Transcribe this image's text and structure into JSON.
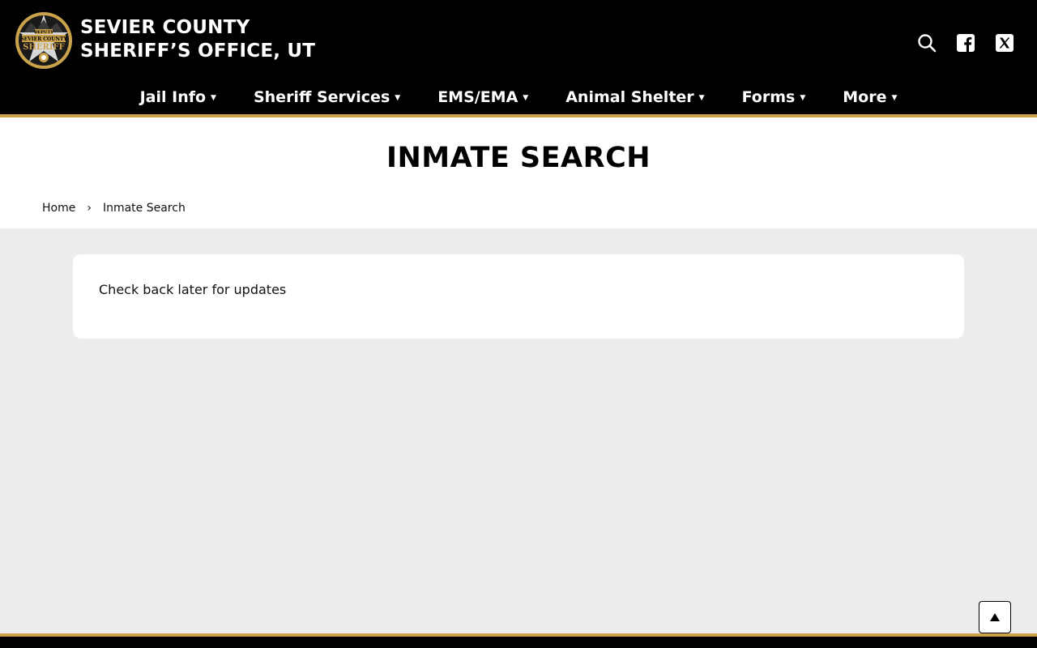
{
  "header": {
    "title_line1": "SEVIER COUNTY",
    "title_line2": "SHERIFF’S OFFICE, UT",
    "logo": {
      "top_text": "DEPUTY",
      "middle_text": "SEVIER COUNTY",
      "bottom_text": "SHERIFF"
    },
    "icons": [
      "search-icon",
      "facebook-icon",
      "x-twitter-icon"
    ]
  },
  "nav": {
    "items": [
      {
        "label": "Jail Info"
      },
      {
        "label": "Sheriff Services"
      },
      {
        "label": "EMS/EMA"
      },
      {
        "label": "Animal Shelter"
      },
      {
        "label": "Forms"
      },
      {
        "label": "More"
      }
    ]
  },
  "page": {
    "title": "INMATE SEARCH"
  },
  "breadcrumb": {
    "home": "Home",
    "separator": "›",
    "current": "Inmate Search"
  },
  "content": {
    "message": "Check back later for updates"
  },
  "colors": {
    "header_bg": "#000000",
    "accent_gold": "#c9a24a",
    "page_bg": "#ededed",
    "card_bg": "#ffffff"
  }
}
